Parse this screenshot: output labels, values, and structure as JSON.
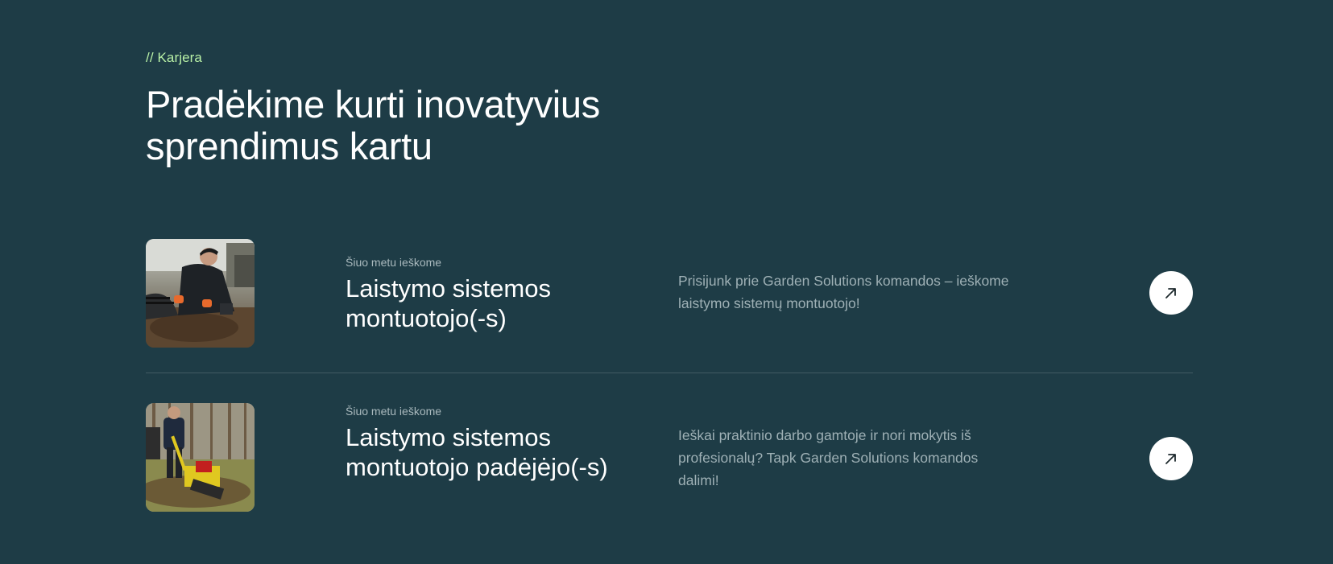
{
  "section": {
    "eyebrow": "// Karjera",
    "heading": "Pradėkime kurti inovatyvius sprendimus kartu"
  },
  "jobs": [
    {
      "overline": "Šiuo metu ieškome",
      "title": "Laistymo sistemos montuotojo(-s)",
      "description": "Prisijunk prie Garden Solutions komandos – ieškome laistymo sistemų montuotojo!",
      "icon": "arrow-up-right-icon"
    },
    {
      "overline": "Šiuo metu ieškome",
      "title": "Laistymo sistemos montuotojo padėjėjo(-s)",
      "description": "Ieškai praktinio darbo gamtoje ir nori mokytis iš profesionalų? Tapk Garden Solutions komandos dalimi!",
      "icon": "arrow-up-right-icon"
    }
  ],
  "colors": {
    "background": "#1e3c46",
    "accent": "#b8f0a6",
    "text": "#ffffff",
    "muted": "#9eb0b5"
  }
}
